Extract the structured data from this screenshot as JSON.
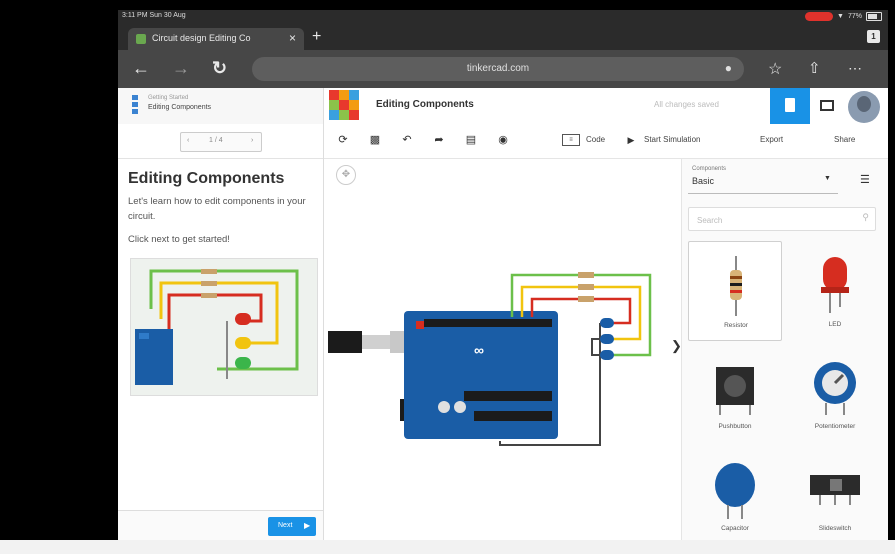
{
  "status_bar": {
    "time": "3:11 PM  Sun 30 Aug",
    "battery": "77%"
  },
  "browser": {
    "tab_title": "Circuit design Editing Co",
    "url": "tinkercad.com",
    "tab_count": "1"
  },
  "header": {
    "lesson_small": "Getting Started",
    "lesson_name": "Editing Components",
    "doc_title": "Editing Components",
    "saved_status": "All changes saved"
  },
  "lesson": {
    "pager_label": "1 / 4",
    "title": "Editing Components",
    "description": "Let's learn how to edit components in your circuit.",
    "instruction": "Click next to get started!",
    "next_label": "Next"
  },
  "toolbar": {
    "code_label": "Code",
    "simulate_label": "Start Simulation",
    "export_label": "Export",
    "share_label": "Share"
  },
  "components_panel": {
    "select_small_label": "Components",
    "select_value": "Basic",
    "search_placeholder": "Search",
    "items": [
      {
        "label": "Resistor"
      },
      {
        "label": "LED"
      },
      {
        "label": "Pushbutton"
      },
      {
        "label": "Potentiometer"
      },
      {
        "label": "Capacitor"
      },
      {
        "label": "Slideswitch"
      }
    ]
  },
  "colors": {
    "accent": "#1992e6",
    "arduino_blue": "#1a5da6",
    "led_red": "#d62d20"
  },
  "icons": [
    "back-icon",
    "forward-icon",
    "reload-icon",
    "mic-icon",
    "star-icon",
    "share-icon",
    "more-icon",
    "rotate-icon",
    "delete-icon",
    "undo-icon",
    "redo-icon",
    "notes-icon",
    "visibility-icon",
    "code-icon",
    "play-icon",
    "list-view-icon",
    "search-icon",
    "fit-view-icon"
  ]
}
